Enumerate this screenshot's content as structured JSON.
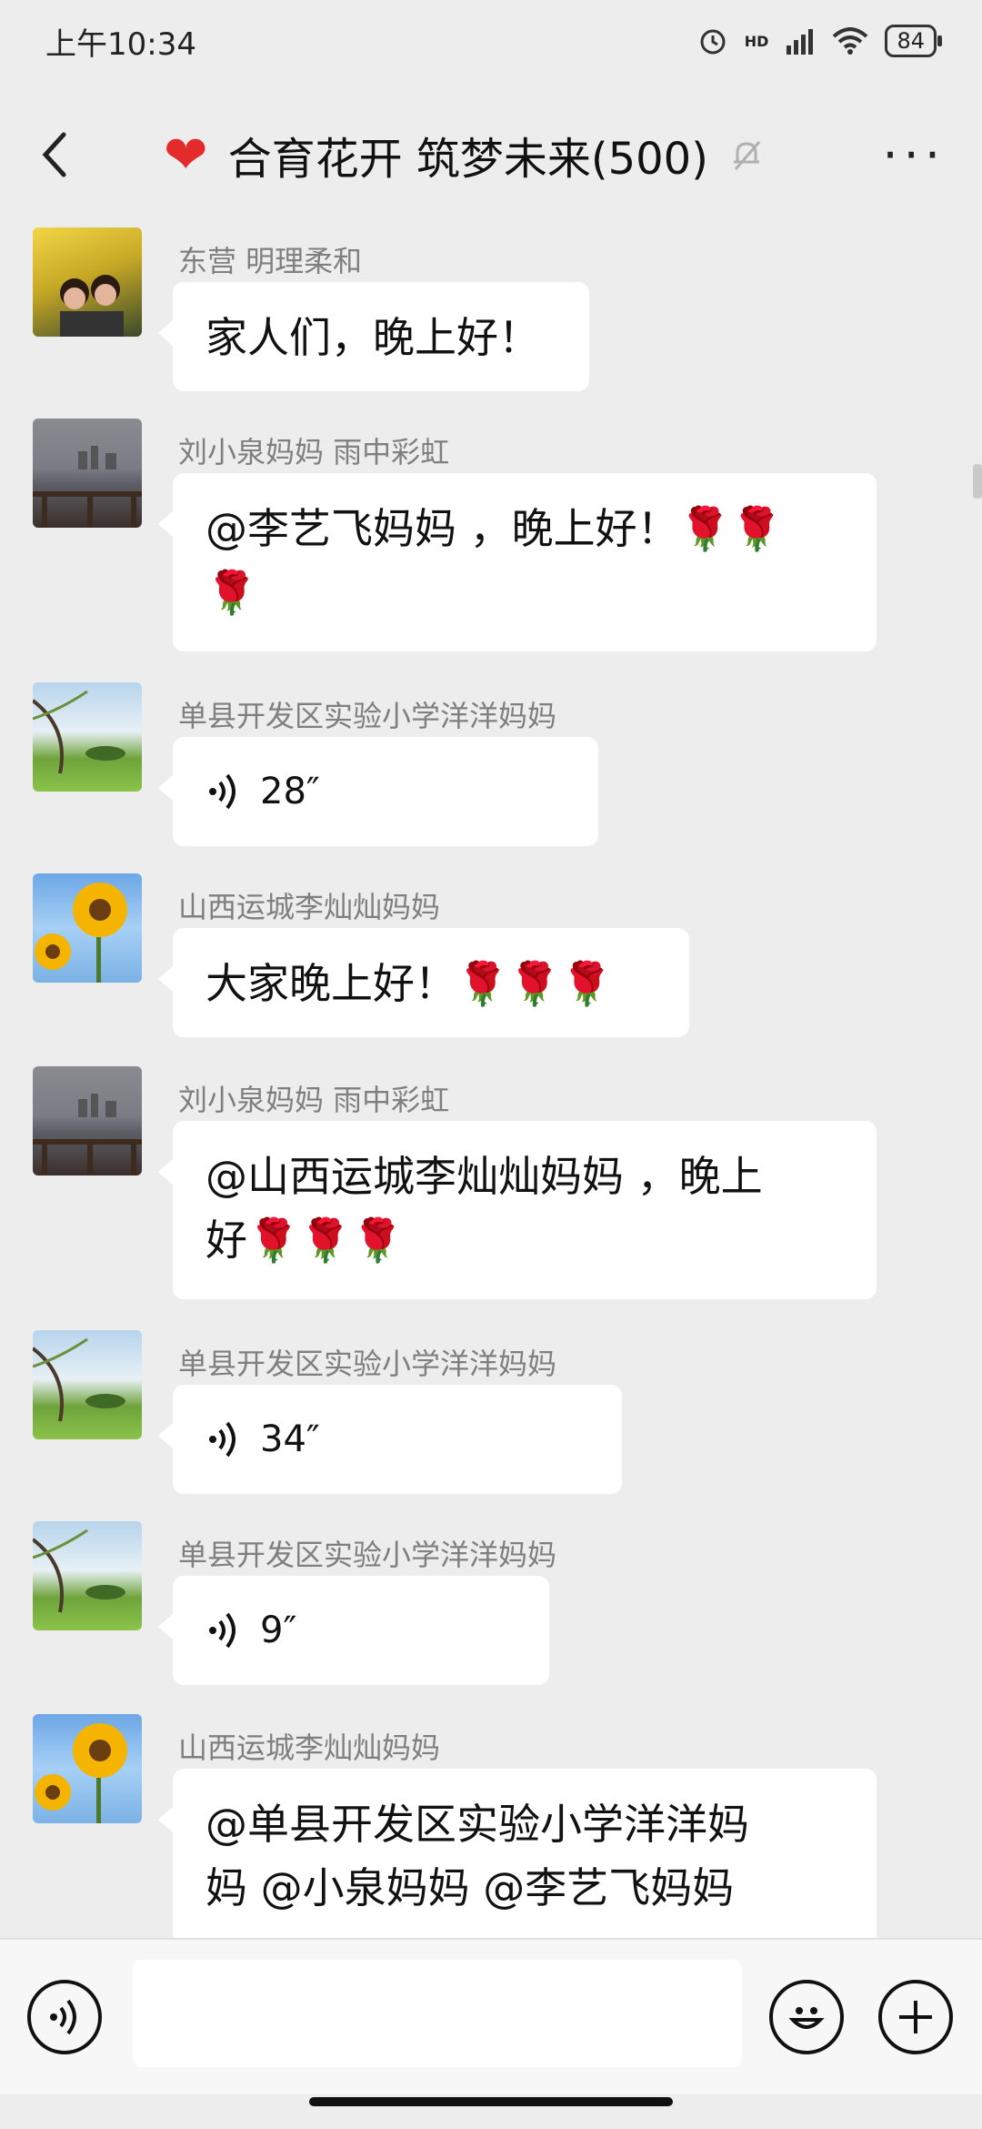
{
  "status": {
    "time": "上午10:34",
    "battery": "84",
    "net": "HD"
  },
  "header": {
    "title": "合育花开 筑梦未来(500)"
  },
  "messages": [
    {
      "sender": "东营  明理柔和",
      "text": "家人们，晚上好！"
    },
    {
      "sender": "刘小泉妈妈  雨中彩虹",
      "text_line1": "@李艺飞妈妈 ，晚上好！🌹🌹",
      "text_line2": "🌹"
    },
    {
      "sender": "单县开发区实验小学洋洋妈妈",
      "voice": "28″"
    },
    {
      "sender": "山西运城李灿灿妈妈",
      "text": "大家晚上好！🌹🌹🌹"
    },
    {
      "sender": "刘小泉妈妈  雨中彩虹",
      "text_line1": "@山西运城李灿灿妈妈 ，晚上",
      "text_line2": "好🌹🌹🌹"
    },
    {
      "sender": "单县开发区实验小学洋洋妈妈",
      "voice": "34″"
    },
    {
      "sender": "单县开发区实验小学洋洋妈妈",
      "voice": "9″"
    },
    {
      "sender": "山西运城李灿灿妈妈",
      "text_line1": "@单县开发区实验小学洋洋妈",
      "text_line2": "妈 @小泉妈妈 @李艺飞妈妈"
    }
  ],
  "colors": {
    "background": "#ededed",
    "bubble": "#ffffff",
    "heart": "#e32b2b"
  }
}
